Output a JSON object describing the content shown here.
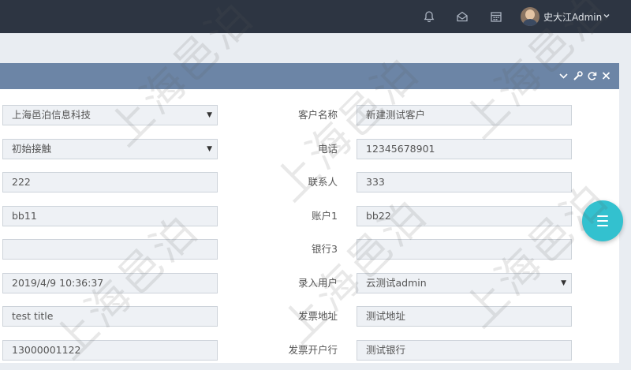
{
  "header": {
    "username": "史大江Admin",
    "icons": [
      "bell-icon",
      "mail-open-icon",
      "calendar-icon",
      "avatar",
      "chevron-down-icon"
    ],
    "background": "#2d3542"
  },
  "panel": {
    "header_color": "#6c85a6",
    "tools": [
      "chevron-down-icon",
      "wrench-icon",
      "refresh-icon",
      "close-icon"
    ]
  },
  "form": {
    "company": "上海邑泊信息科技",
    "stage": "初始接触",
    "field_222": "222",
    "field_bb11": "bb11",
    "empty_field": "",
    "entry_time": "2019/4/9 10:36:37",
    "title": "test title",
    "phone_left": "13000001122",
    "customer_name_label": "客户名称",
    "customer_name": "新建测试客户",
    "phone_label": "电话",
    "phone": "12345678901",
    "contact_label": "联系人",
    "contact": "333",
    "account1_label": "账户1",
    "account1": "bb22",
    "bank3_label": "银行3",
    "bank3": "",
    "entry_user_label": "录入用户",
    "entry_user": "云测试admin",
    "invoice_address_label": "发票地址",
    "invoice_address": "测试地址",
    "invoice_bank_label": "发票开户行",
    "invoice_bank": "测试银行"
  },
  "watermark": "上海邑泊",
  "fab_color": "#33c1cf"
}
